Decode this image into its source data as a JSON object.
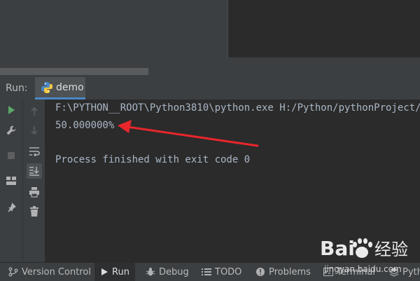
{
  "run_panel": {
    "label": "Run:",
    "tab": {
      "name": "demo",
      "icon": "python-icon"
    }
  },
  "console": {
    "lines": [
      "F:\\PYTHON__ROOT\\Python3810\\python.exe H:/Python/pythonProject/",
      "50.000000%",
      "",
      "Process finished with exit code 0"
    ]
  },
  "toolbar_left": [
    "run-icon",
    "wrench-icon",
    "stop-icon",
    "layout-icon",
    "pin-icon"
  ],
  "toolbar_right": [
    "up-arrow-icon",
    "down-arrow-icon",
    "soft-wrap-icon",
    "scroll-to-end-icon",
    "print-icon",
    "trash-icon"
  ],
  "status_bar": {
    "items": [
      {
        "label": "Version Control",
        "icon": "branch-icon"
      },
      {
        "label": "Run",
        "icon": "play-icon"
      },
      {
        "label": "Debug",
        "icon": "bug-icon"
      },
      {
        "label": "TODO",
        "icon": "list-icon"
      },
      {
        "label": "Problems",
        "icon": "info-icon"
      },
      {
        "label": "Terminal",
        "icon": "terminal-icon"
      },
      {
        "label": "Pyth",
        "icon": "layers-icon"
      }
    ]
  },
  "watermark": {
    "text": "jingyan.baidu.com",
    "logo": "Bai度经验"
  },
  "colors": {
    "accent": "#4a88c7",
    "arrow": "#e8262b",
    "run_green": "#59a869"
  }
}
